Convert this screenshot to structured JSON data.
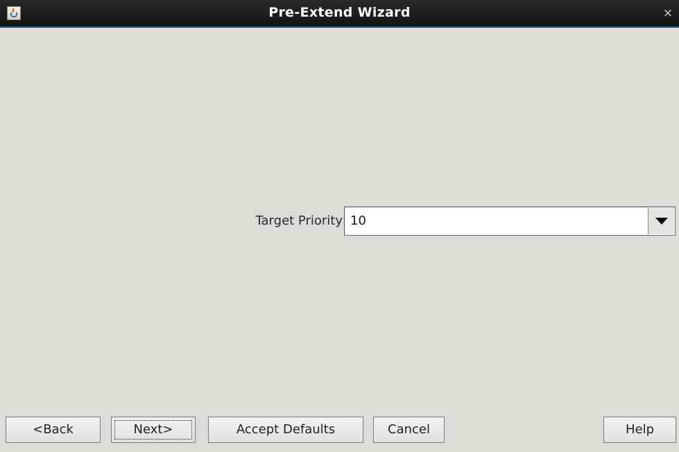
{
  "window": {
    "title": "Pre-Extend Wizard",
    "app_icon": "java-cup-icon",
    "close_glyph": "×"
  },
  "form": {
    "target_priority_label": "Target Priority",
    "target_priority_value": "10"
  },
  "buttons": {
    "back": "<Back",
    "next": "Next>",
    "accept_defaults": "Accept Defaults",
    "cancel": "Cancel",
    "help": "Help"
  },
  "colors": {
    "titlebar": "#1c1c1c",
    "titlebar_accent": "#1c5a8a",
    "background": "#dedad6"
  }
}
